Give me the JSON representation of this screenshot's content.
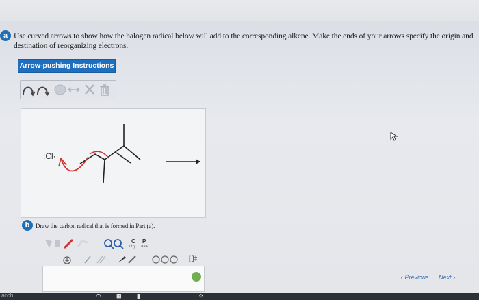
{
  "part_a": {
    "badge": "a",
    "question_line1": "Use curved arrows to show how the halogen radical below will add to the corresponding alkene. Make the ends of your arrows specify the origin and",
    "question_line2": "destination of reorganizing electrons.",
    "instructions_button": "Arrow-pushing Instructions",
    "toolbar_icons": [
      "curved-arrow-single-icon",
      "curved-arrow-double-icon",
      "ellipse-icon",
      "resize-arrows-icon",
      "clear-x-icon",
      "trash-icon"
    ],
    "molecule_label": ":Cl·",
    "reaction_arrow": "→"
  },
  "part_b": {
    "badge": "b",
    "question": "Draw the carbon radical that is formed in Part (a).",
    "tool_labels": {
      "c_label": "C",
      "p_label": "P",
      "chain_label": "chy",
      "scale_label": "aale"
    },
    "bracket_label": "[ ]‡"
  },
  "navigation": {
    "previous": "Previous",
    "next": "Next"
  },
  "taskbar": {
    "search_label": "arch"
  },
  "colors": {
    "accent_blue": "#1e6fbf",
    "arrow_red": "#d1342f",
    "next_purple": "#6c2ea6"
  }
}
